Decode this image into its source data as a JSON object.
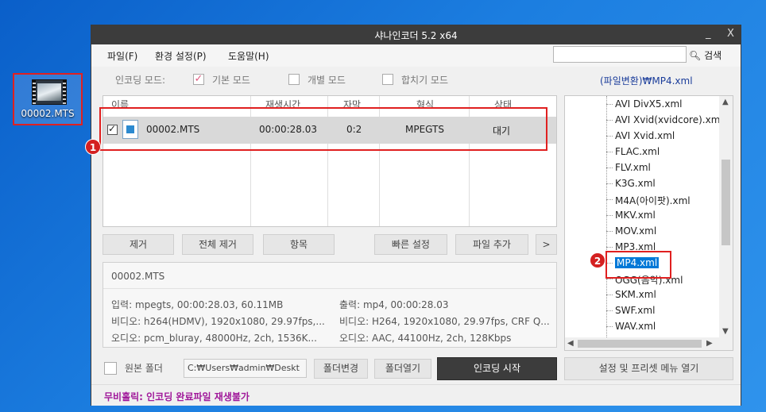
{
  "desktop": {
    "icon_label": "00002.MTS"
  },
  "window": {
    "title": "샤나인코더  5.2  x64",
    "min_label": "_",
    "close_label": "X"
  },
  "menu": {
    "items": [
      "파일(F)",
      "환경 설정(P)",
      "도움말(H)"
    ],
    "search_value": "",
    "search_label": "검색"
  },
  "modes": {
    "label": "인코딩 모드:",
    "options": [
      {
        "label": "기본 모드",
        "checked": true
      },
      {
        "label": "개별 모드",
        "checked": false
      },
      {
        "label": "합치기 모드",
        "checked": false
      }
    ],
    "profile_path": "(파일변환)₩MP4.xml"
  },
  "table": {
    "headers": [
      "이름",
      "재생시간",
      "자막",
      "형식",
      "상태"
    ],
    "rows": [
      {
        "checked": true,
        "name": "00002.MTS",
        "duration": "00:00:28.03",
        "subtitle": "0:2",
        "format": "MPEGTS",
        "status": "대기"
      }
    ]
  },
  "buttons": {
    "remove": "제거",
    "remove_all": "전체 제거",
    "items": "항목",
    "quick_settings": "빠른 설정",
    "add_file": "파일 추가",
    "more": ">",
    "folder_change": "폴더변경",
    "folder_open": "폴더열기",
    "start_encoding": "인코딩 시작",
    "preset_menu": "설정 및 프리셋 메뉴 열기"
  },
  "info": {
    "filename": "00002.MTS",
    "input": "입력: mpegts, 00:00:28.03, 60.11MB",
    "video_in": "비디오: h264(HDMV), 1920x1080, 29.97fps,...",
    "audio_in": "오디오: pcm_bluray, 48000Hz, 2ch, 1536K...",
    "output": "출력: mp4, 00:00:28.03",
    "video_out": "비디오: H264, 1920x1080, 29.97fps, CRF Q...",
    "audio_out": "오디오: AAC, 44100Hz, 2ch, 128Kbps"
  },
  "presets": {
    "items": [
      "AVI DivX5.xml",
      "AVI Xvid(xvidcore).xml",
      "AVI Xvid.xml",
      "FLAC.xml",
      "FLV.xml",
      "K3G.xml",
      "M4A(아이팟).xml",
      "MKV.xml",
      "MOV.xml",
      "MP3.xml",
      "MP4.xml",
      "OGG(음악).xml",
      "SKM.xml",
      "SWF.xml",
      "WAV.xml"
    ],
    "selected": "MP4.xml"
  },
  "output": {
    "label": "원본 폴더",
    "path": "C:₩Users₩admin₩Deskt"
  },
  "status": {
    "message": "무비홀릭: 인코딩 완료파일 재생불가"
  },
  "annotations": {
    "badge1": "1",
    "badge2": "2"
  },
  "colors": {
    "title_bar": "#3c3c3c",
    "annotation": "#e02020",
    "selection": "#0078d7",
    "status_text": "#a0189a"
  }
}
